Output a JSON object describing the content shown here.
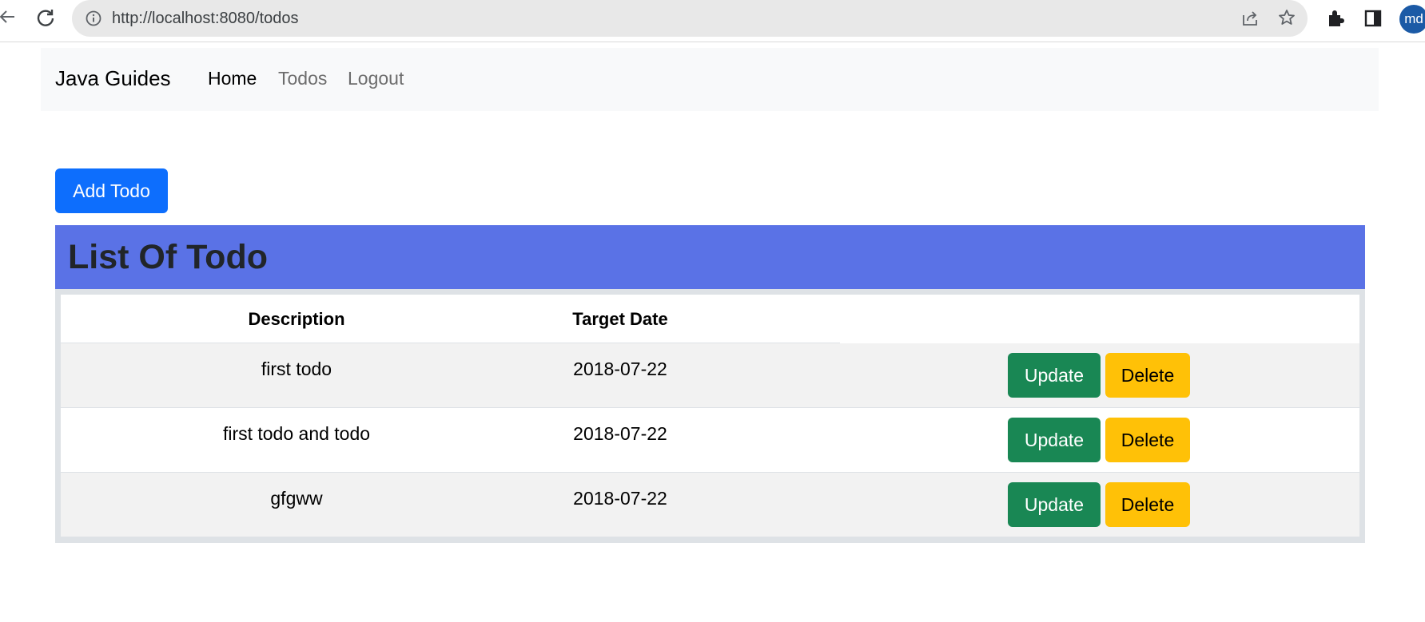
{
  "browser": {
    "url": "http://localhost:8080/todos",
    "avatar_initials": "md",
    "icons": [
      "back-arrow-icon",
      "reload-icon",
      "info-icon",
      "share-icon",
      "star-icon",
      "extensions-icon",
      "side-panel-icon"
    ]
  },
  "navbar": {
    "brand": "Java Guides",
    "links": [
      "Home",
      "Todos",
      "Logout"
    ]
  },
  "actions": {
    "add_label": "Add Todo"
  },
  "card": {
    "title": "List Of Todo",
    "header_color": "#5a72e6"
  },
  "table": {
    "columns": [
      "Description",
      "Target Date",
      ""
    ],
    "rows": [
      {
        "description": "first todo",
        "target_date": "2018-07-22",
        "update": "Update",
        "delete": "Delete"
      },
      {
        "description": "first todo and todo",
        "target_date": "2018-07-22",
        "update": "Update",
        "delete": "Delete"
      },
      {
        "description": "gfgww",
        "target_date": "2018-07-22",
        "update": "Update",
        "delete": "Delete"
      }
    ]
  },
  "colors": {
    "primary": "#0d6efd",
    "success": "#198754",
    "warning": "#ffc107"
  }
}
